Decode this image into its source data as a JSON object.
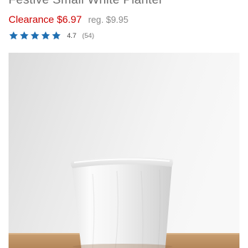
{
  "product": {
    "title": "Festive Small White Planter",
    "price": {
      "clearance": "Clearance $6.97",
      "regular": "reg. $9.95",
      "clearance_color": "#cc0000"
    },
    "rating": {
      "value": "4.7",
      "count": "(54)",
      "stars": 5,
      "star_color": "#1f6fb2"
    },
    "image": {
      "subject": "white ceramic planter on wooden surface"
    }
  }
}
